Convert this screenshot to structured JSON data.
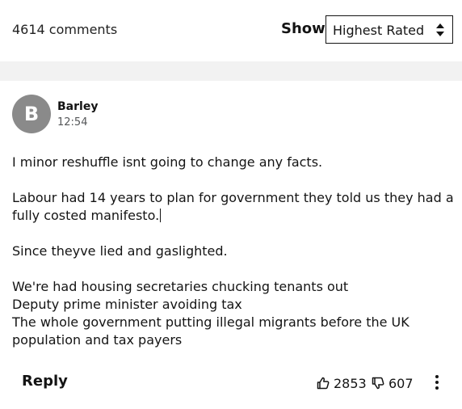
{
  "header": {
    "comments_count": "4614 comments",
    "sort_label": "Show",
    "sort_value": "Highest Rated"
  },
  "comment": {
    "avatar_initial": "B",
    "author": "Barley",
    "time": "12:54",
    "paragraphs": [
      "I minor reshuffle isnt going to change any facts.",
      "Labour had 14 years to plan for government they told us they had a fully costed manifesto.",
      "Since theyve lied and gaslighted.",
      "We're had housing secretaries chucking tenants out\nDeputy prime minister avoiding tax\nThe whole government putting illegal migrants before the UK population and tax payers"
    ],
    "reply_label": "Reply",
    "upvotes": "2853",
    "downvotes": "607"
  },
  "icons": {
    "upvote": "thumbs-up-icon",
    "downvote": "thumbs-down-icon",
    "more": "more-options-icon",
    "sort_arrows": "chevron-up-down-icon"
  },
  "colors": {
    "text": "#141414",
    "avatar_bg": "#8a8a8a",
    "band": "#f2f2f2"
  }
}
